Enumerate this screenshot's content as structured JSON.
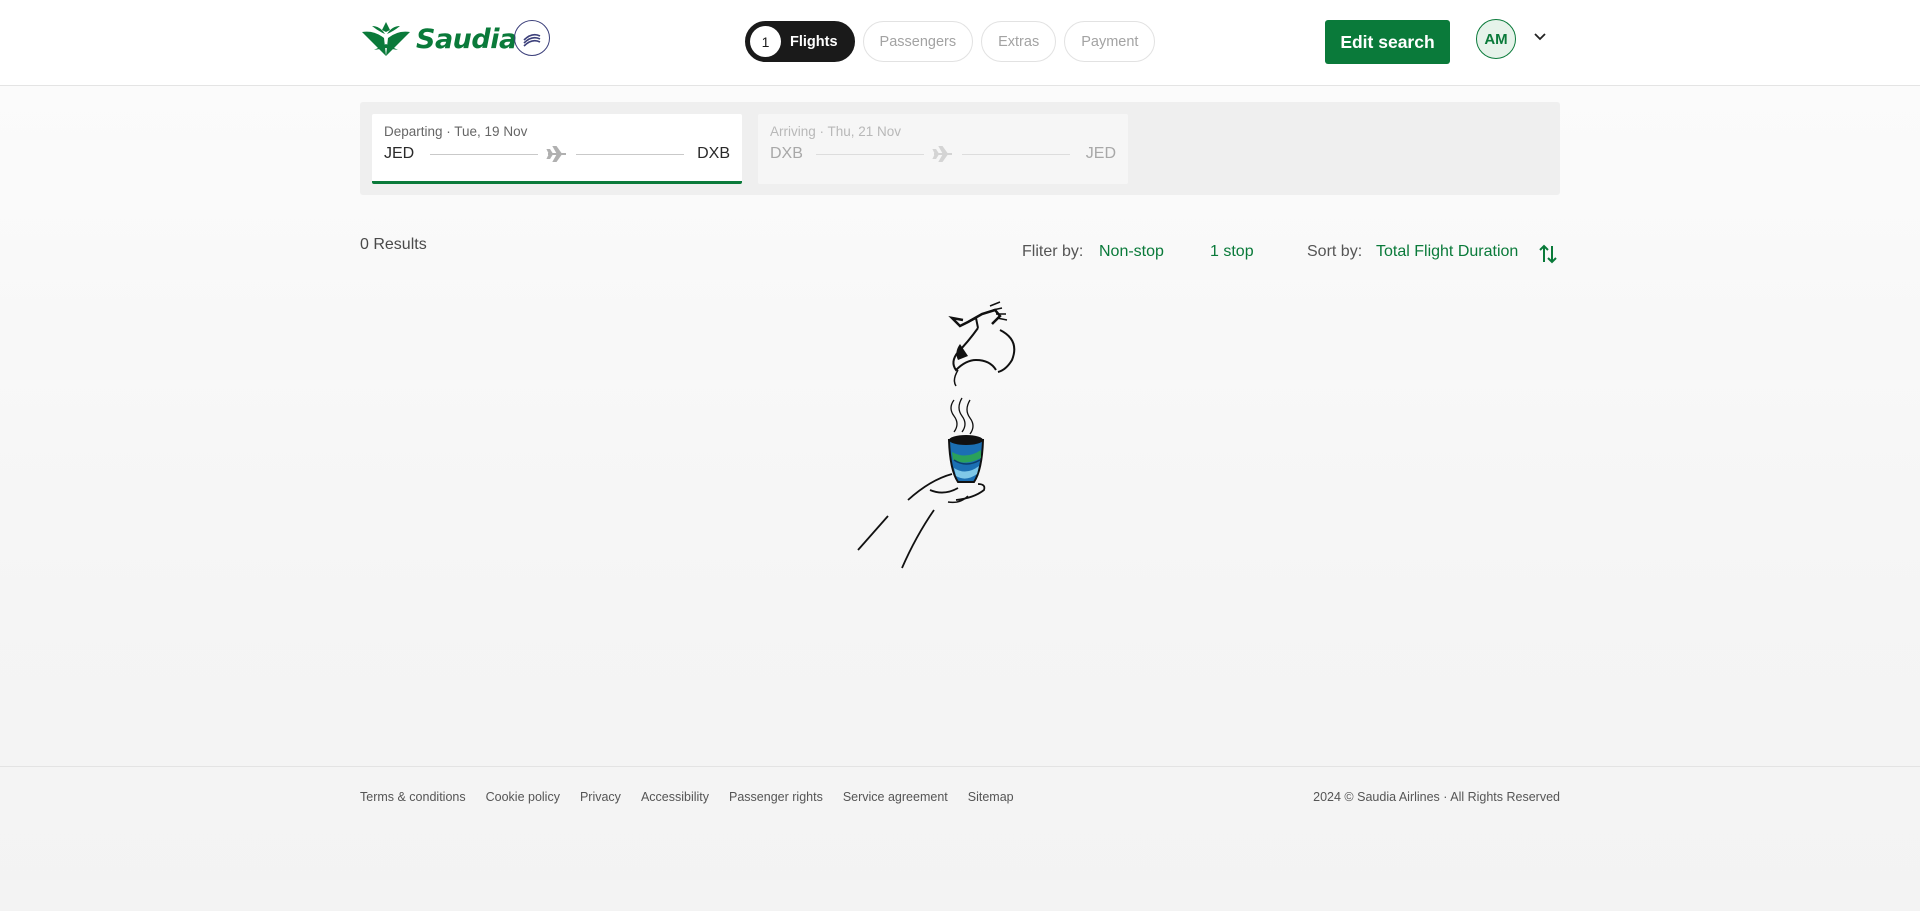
{
  "brand": {
    "name": "Saudia",
    "alliance_logo": "SKYTEAM",
    "accent": "#0a7a3a"
  },
  "steps": [
    {
      "number": "1",
      "label": "Flights",
      "active": true
    },
    {
      "label": "Passengers"
    },
    {
      "label": "Extras"
    },
    {
      "label": "Payment"
    }
  ],
  "header": {
    "edit_search": "Edit search",
    "avatar_initials": "AM"
  },
  "legs": [
    {
      "label": "Departing · Tue, 19 Nov",
      "from": "JED",
      "to": "DXB",
      "active": true
    },
    {
      "label": "Arriving · Thu, 21 Nov",
      "from": "DXB",
      "to": "JED",
      "active": false
    }
  ],
  "results": {
    "count_text": "0 Results",
    "filter_label": "Fliter by:",
    "filters": [
      "Non-stop",
      "1 stop"
    ],
    "sort_label": "Sort by:",
    "sort_value": "Total Flight Duration"
  },
  "footer": {
    "links": [
      "Terms & conditions",
      "Cookie policy",
      "Privacy",
      "Accessibility",
      "Passenger rights",
      "Service agreement",
      "Sitemap"
    ],
    "copyright": "2024 © Saudia Airlines · All Rights Reserved"
  },
  "icons": [
    "saudia-logo-icon",
    "skyteam-logo-icon",
    "chevron-down-icon",
    "plane-icon",
    "sort-icon",
    "coffee-illustration"
  ]
}
